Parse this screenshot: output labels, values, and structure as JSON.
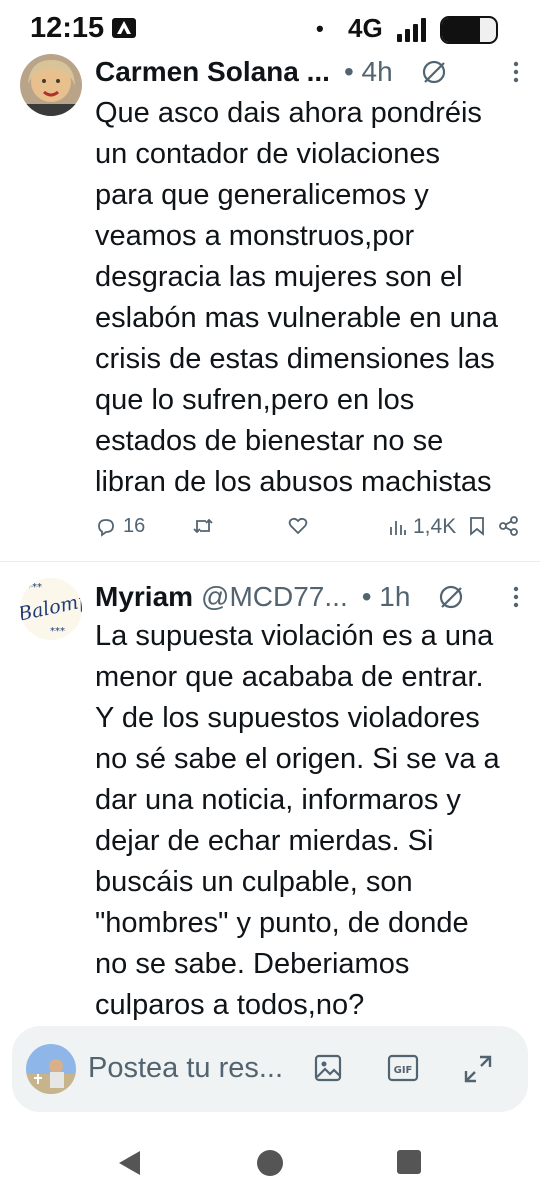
{
  "status_bar": {
    "time": "12:15",
    "notification_icon": "android-auto-icon",
    "dot": "•",
    "network": "4G",
    "signal_icon": "signal-bars-icon",
    "battery_icon": "battery-icon"
  },
  "tweets": [
    {
      "display_name": "Carmen Solana ...",
      "handle": "",
      "time": "• 4h",
      "text": "Que asco dais ahora pondréis\nun contador de violaciones\npara que generalicemos y\nveamos a monstruos,por\ndesgracia las mujeres son el\neslabón mas vulnerable en una\ncrisis de estas dimensiones las\nque lo sufren,pero en los\nestados de bienestar no se\nlibran de los abusos machistas",
      "replies": "16",
      "views": "1,4K"
    },
    {
      "display_name": "Myriam",
      "handle": "@MCD77...",
      "time": "• 1h",
      "text": "La supuesta violación es a una\nmenor que acababa de entrar.\nY de los supuestos violadores\nno sé sabe el origen. Si se va a\ndar una noticia, informaros y\ndejar de echar mierdas.  Si\nbuscáis un culpable, son\n\"hombres\" y punto, de donde\nno se sabe. Deberiamos\nculparos a todos,no?",
      "avatar_text": "Balompi"
    }
  ],
  "reply_bar": {
    "placeholder": "Postea tu res...",
    "icons": [
      "image-icon",
      "gif-icon",
      "expand-icon"
    ],
    "gif_label": "GIF"
  },
  "nav": {
    "icons": [
      "back-icon",
      "home-icon",
      "recents-icon"
    ]
  },
  "colors": {
    "text": "#0f1419",
    "secondary": "#536471",
    "divider": "#e6ecf0",
    "reply_bg": "#eff3f4"
  }
}
